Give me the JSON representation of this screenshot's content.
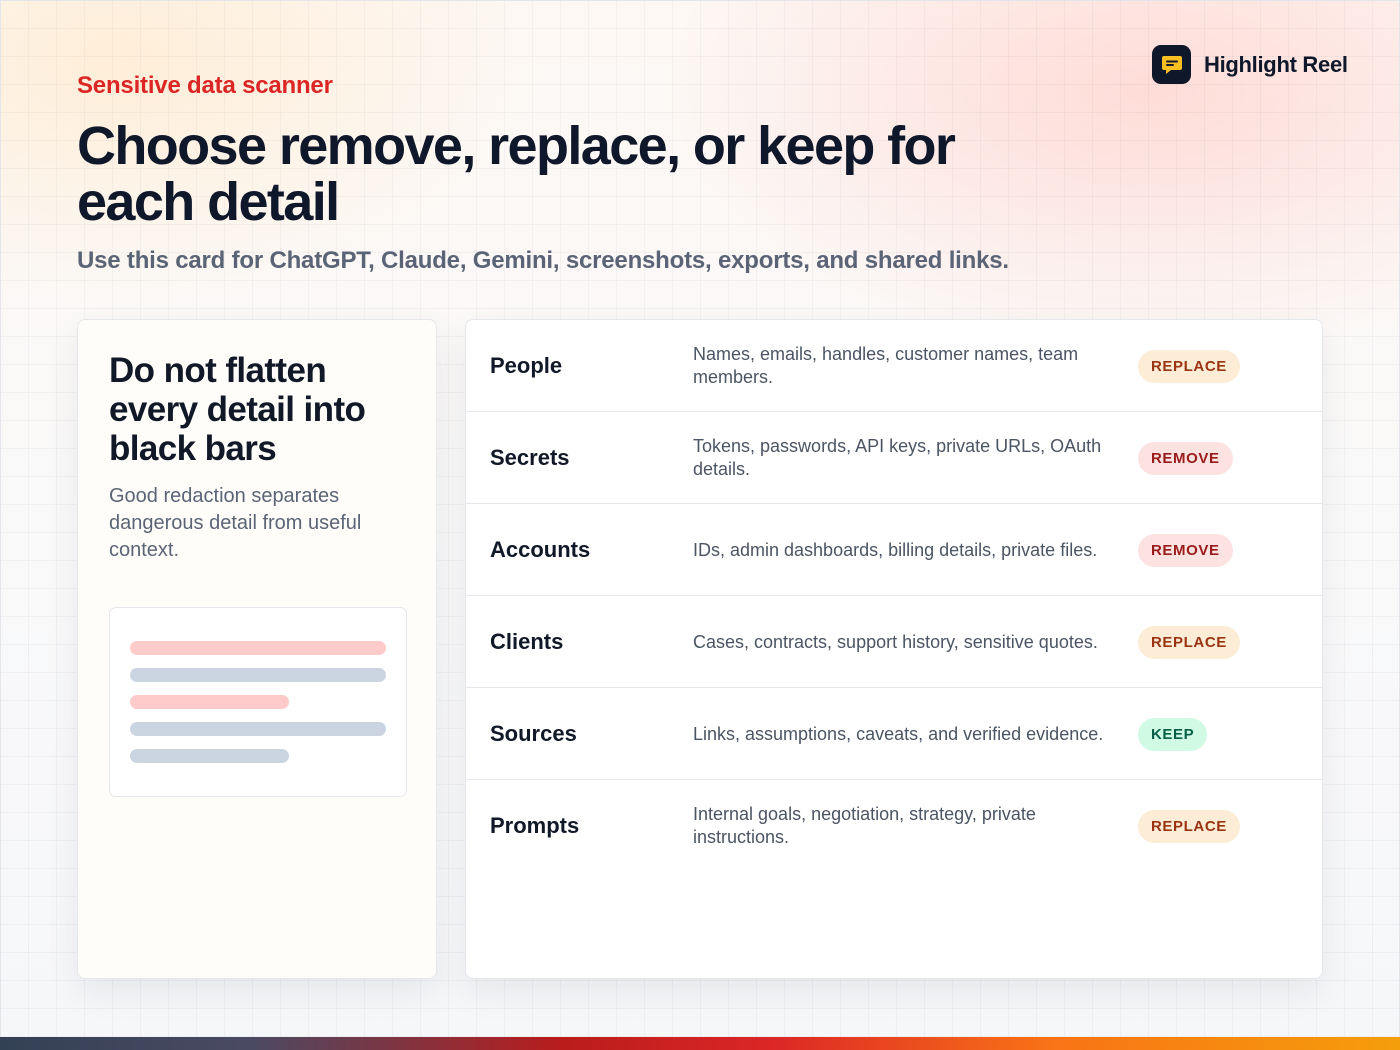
{
  "brand": {
    "name": "Highlight Reel",
    "icon": "chat-bubble-icon"
  },
  "eyebrow": "Sensitive data scanner",
  "headline": "Choose remove, replace, or keep for each detail",
  "subtitle": "Use this card for ChatGPT, Claude, Gemini, screenshots, exports, and shared links.",
  "left_card": {
    "title": "Do not flatten every detail into black bars",
    "body": "Good redaction separates dangerous detail from useful context.",
    "illustration": {
      "bars": [
        {
          "color": "#fecaca",
          "length": 1.0
        },
        {
          "color": "#cbd5e1",
          "length": 1.0
        },
        {
          "color": "#fecaca",
          "length": 0.62
        },
        {
          "color": "#cbd5e1",
          "length": 1.0
        },
        {
          "color": "#cbd5e1",
          "length": 0.62
        }
      ]
    }
  },
  "rows": [
    {
      "label": "People",
      "description": "Names, emails, handles, customer names, team members.",
      "action": "REPLACE",
      "kind": "replace"
    },
    {
      "label": "Secrets",
      "description": "Tokens, passwords, API keys, private URLs, OAuth details.",
      "action": "REMOVE",
      "kind": "remove"
    },
    {
      "label": "Accounts",
      "description": "IDs, admin dashboards, billing details, private files.",
      "action": "REMOVE",
      "kind": "remove"
    },
    {
      "label": "Clients",
      "description": "Cases, contracts, support history, sensitive quotes.",
      "action": "REPLACE",
      "kind": "replace"
    },
    {
      "label": "Sources",
      "description": "Links, assumptions, caveats, and verified evidence.",
      "action": "KEEP",
      "kind": "keep"
    },
    {
      "label": "Prompts",
      "description": "Internal goals, negotiation, strategy, private instructions.",
      "action": "REPLACE",
      "kind": "replace"
    }
  ],
  "colors": {
    "eyebrow": "#dc2626",
    "replace": "#9a3412",
    "remove": "#991b1b",
    "keep": "#065f46"
  }
}
